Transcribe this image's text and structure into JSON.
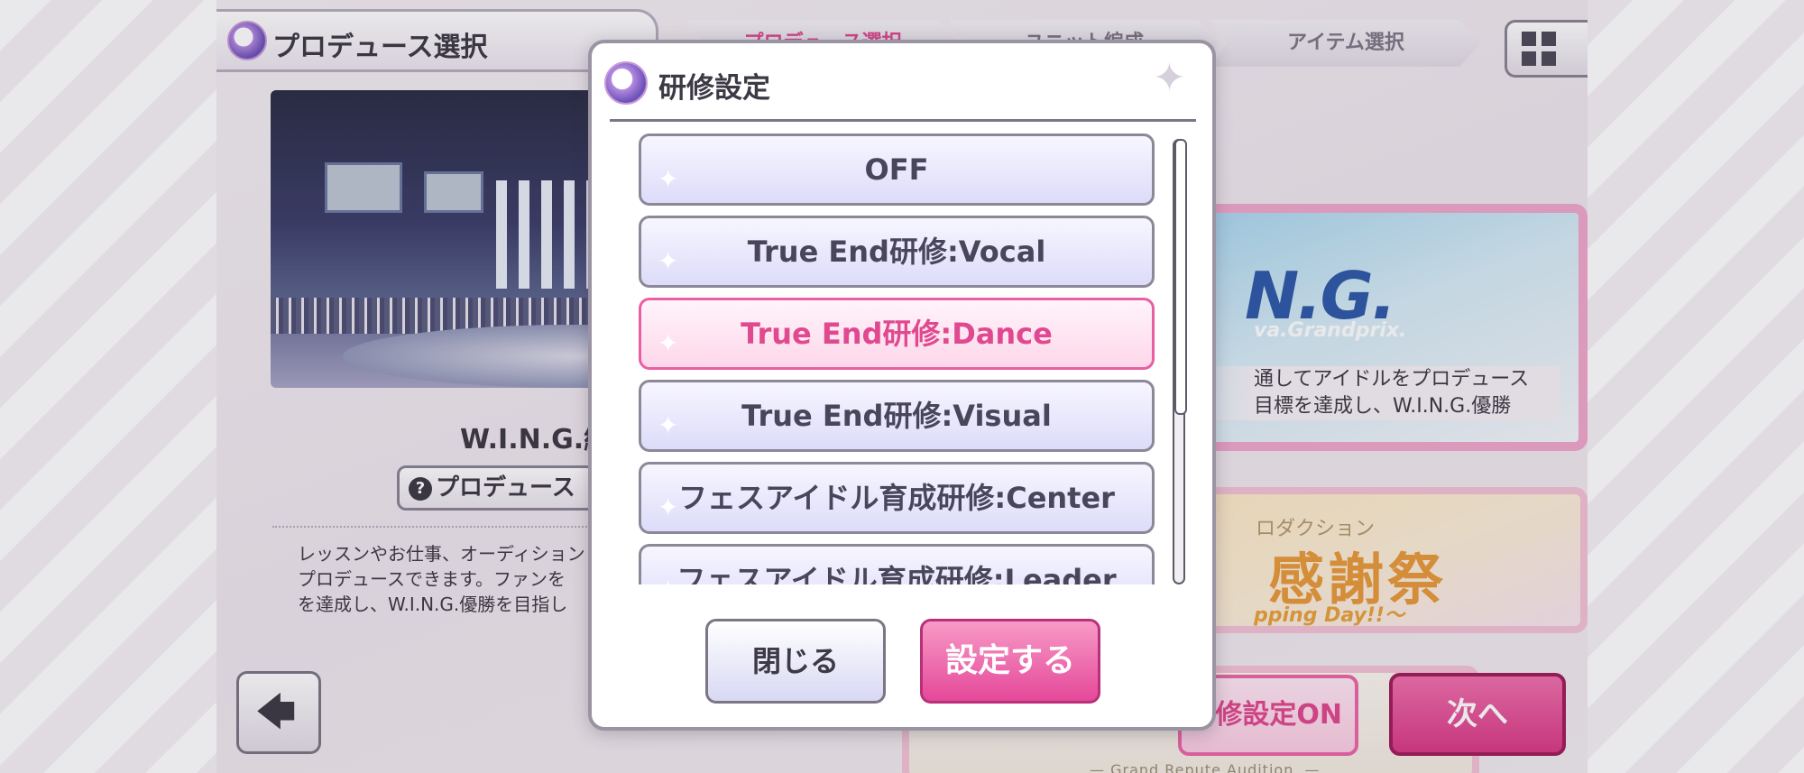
{
  "header": {
    "title": "プロデュース選択",
    "steps": [
      "プロデュース選択",
      "ユニット編成",
      "アイテム選択"
    ]
  },
  "left_panel": {
    "mode_name": "W.I.N.G.編",
    "info_button": "プロデュース",
    "description": [
      "レッスンやお仕事、オーディション",
      "プロデュースできます。ファンを",
      "を達成し、W.I.N.G.優勝を目指し"
    ]
  },
  "right_panel": {
    "wing_card": {
      "logo": "W.I.N.G.",
      "subtitle": "Wonder Idol Nova.Grandprix.",
      "visible_logo": "N.G.",
      "visible_subtitle": "va.Grandprix.",
      "text": [
        "通してアイドルをプロデュース",
        "目標を達成し、W.I.N.G.優勝"
      ]
    },
    "fest_card": {
      "small_text": "ロダクション",
      "big_text": "感謝祭",
      "english": "pping Day!!〜"
    },
    "gra_card": {
      "text": "— Grand.Repute.Audition. —"
    },
    "training_button": "研修設定ON",
    "next_button": "次へ"
  },
  "modal": {
    "title": "研修設定",
    "options": [
      "OFF",
      "True End研修:Vocal",
      "True End研修:Dance",
      "True End研修:Visual",
      "フェスアイドル育成研修:Center",
      "フェスアイドル育成研修:Leader"
    ],
    "selected_index": 2,
    "close_button": "閉じる",
    "confirm_button": "設定する"
  },
  "colors": {
    "accent_pink": "#e0498f",
    "option_lavender": "#dddcf9",
    "text_dark": "#3d3a45"
  }
}
